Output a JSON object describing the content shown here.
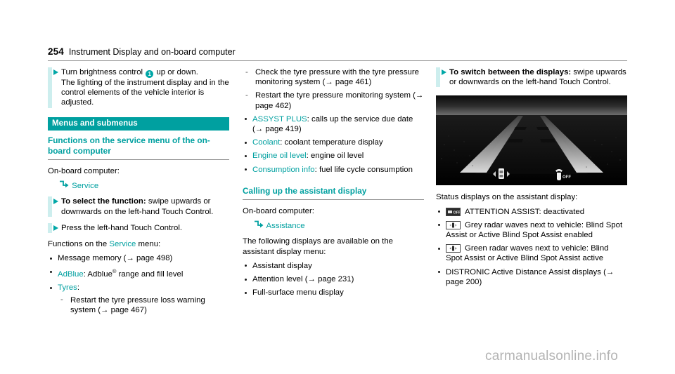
{
  "header": {
    "page_number": "254",
    "chapter": "Instrument Display and on-board computer"
  },
  "column_left": {
    "instruction_brightness": {
      "line1_pre": "Turn brightness control ",
      "marker": "1",
      "line1_post": " up or down.",
      "line2": "The lighting of the instrument display and in the control elements of the vehicle interior is adjusted."
    },
    "band_heading": "Menus and submenus",
    "section_heading": "Functions on the service menu of the on-board computer",
    "onboard_label": "On-board computer:",
    "menu_path": "Service",
    "instruction_select": {
      "bold": "To select the function:",
      "rest": " swipe upwards or downwards on the left-hand Touch Control."
    },
    "instruction_press": "Press the left-hand Touch Control.",
    "functions_intro_pre": "Functions on the ",
    "functions_intro_link": "Service",
    "functions_intro_post": " menu:",
    "functions": [
      {
        "plain": "Message memory (→ page 498)"
      },
      {
        "teal": "AdBlue",
        "rest": ": Adblue® range and fill level"
      },
      {
        "teal": "Tyres",
        "rest": ":"
      }
    ],
    "tyres_sub": [
      "Restart the tyre pressure loss warning system (→ page 467)"
    ]
  },
  "column_middle": {
    "dashes_top": [
      "Check the tyre pressure with the tyre pressure monitoring system (→ page 461)",
      "Restart the tyre pressure monitoring system (→ page 462)"
    ],
    "functions": [
      {
        "teal": "ASSYST PLUS",
        "rest": ": calls up the service due date (→ page 419)"
      },
      {
        "teal": "Coolant",
        "rest": ": coolant temperature display"
      },
      {
        "teal": "Engine oil level",
        "rest": ": engine oil level"
      },
      {
        "teal": "Consumption info",
        "rest": ": fuel life cycle consumption"
      }
    ],
    "section_heading": "Calling up the assistant display",
    "onboard_label": "On-board computer:",
    "menu_path": "Assistance",
    "intro": "The following displays are available on the assistant display menu:",
    "displays": [
      "Assistant display",
      "Attention level (→ page 231)",
      "Full-surface menu display"
    ]
  },
  "column_right": {
    "instruction_switch": {
      "bold": "To switch between the displays:",
      "rest": " swipe upwards or downwards on the left-hand Touch Control."
    },
    "image_alt": "assistant-display-road-view",
    "status_intro": "Status displays on the assistant display:",
    "status_items": [
      {
        "icon": "attention-assist-off-icon",
        "text": "ATTENTION ASSIST: deactivated"
      },
      {
        "icon": "grey-radar-waves-icon",
        "text": "Grey radar waves next to vehicle: Blind Spot Assist or Active Blind Spot Assist enabled"
      },
      {
        "icon": "green-radar-waves-icon",
        "text": "Green radar waves next to vehicle: Blind Spot Assist or Active Blind Spot Assist active"
      },
      {
        "icon": null,
        "text": "DISTRONIC Active Distance Assist displays (→ page 200)"
      }
    ]
  },
  "watermark": {
    "text": "carmanualsonline.info"
  },
  "colors": {
    "teal": "#00a0a0",
    "light_cyan": "#cdeeee",
    "watermark_grey": "#b3b3b3"
  }
}
